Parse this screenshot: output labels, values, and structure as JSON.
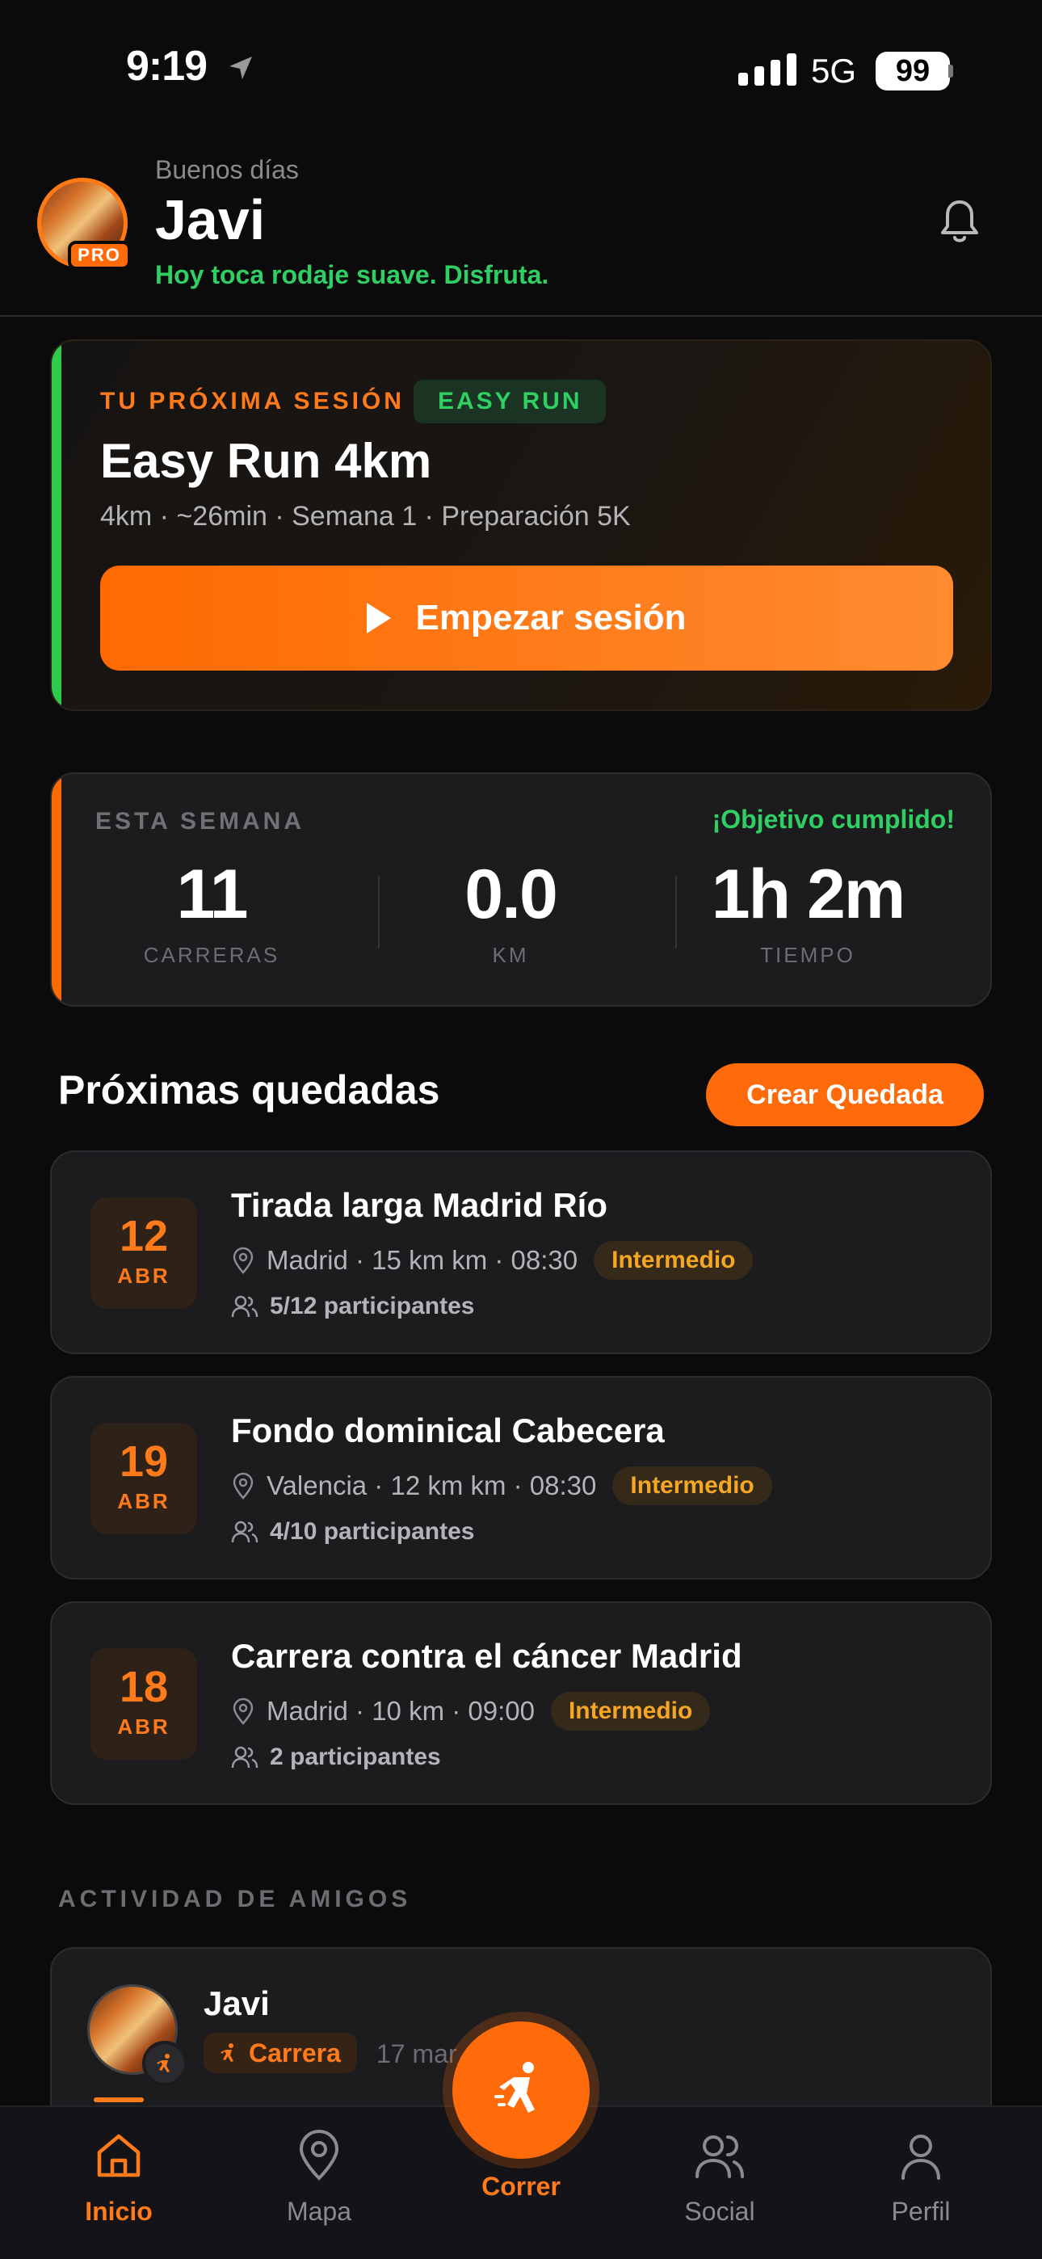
{
  "status_bar": {
    "time": "9:19",
    "network": "5G",
    "battery": "99"
  },
  "header": {
    "greeting": "Buenos días",
    "name": "Javi",
    "tagline": "Hoy toca rodaje suave. Disfruta.",
    "badge": "PRO"
  },
  "next_session": {
    "kicker": "TU PRÓXIMA SESIÓN",
    "tag": "EASY RUN",
    "title": "Easy Run 4km",
    "meta": "4km · ~26min · Semana 1 · Preparación 5K",
    "button": "Empezar sesión"
  },
  "week": {
    "label": "ESTA SEMANA",
    "goal": "¡Objetivo cumplido!",
    "stats": [
      {
        "value": "11",
        "label": "CARRERAS"
      },
      {
        "value": "0.0",
        "label": "KM"
      },
      {
        "value": "1h 2m",
        "label": "TIEMPO"
      }
    ]
  },
  "meetups": {
    "title": "Próximas quedadas",
    "create_button": "Crear Quedada",
    "items": [
      {
        "day": "12",
        "month": "ABR",
        "title": "Tirada larga Madrid Río",
        "meta": "Madrid · 15 km km · 08:30",
        "level": "Intermedio",
        "participants": "5/12 participantes"
      },
      {
        "day": "19",
        "month": "ABR",
        "title": "Fondo dominical Cabecera",
        "meta": "Valencia · 12 km km · 08:30",
        "level": "Intermedio",
        "participants": "4/10 participantes"
      },
      {
        "day": "18",
        "month": "ABR",
        "title": "Carrera contra el cáncer Madrid",
        "meta": "Madrid · 10 km · 09:00",
        "level": "Intermedio",
        "participants": "2 participantes"
      }
    ]
  },
  "friends": {
    "label": "ACTIVIDAD DE AMIGOS",
    "items": [
      {
        "name": "Javi",
        "type": "Carrera",
        "date": "17 mar"
      }
    ]
  },
  "tabbar": {
    "tabs": [
      {
        "label": "Inicio",
        "icon": "home-icon",
        "active": true
      },
      {
        "label": "Mapa",
        "icon": "map-pin-icon"
      },
      {
        "label": "Correr",
        "icon": "runner-icon"
      },
      {
        "label": "Social",
        "icon": "users-icon"
      },
      {
        "label": "Perfil",
        "icon": "person-icon"
      }
    ]
  },
  "colors": {
    "accent": "#ff6a0a",
    "success": "#2fcf63",
    "background": "#0b0b0c",
    "card": "#1c1c1f"
  }
}
